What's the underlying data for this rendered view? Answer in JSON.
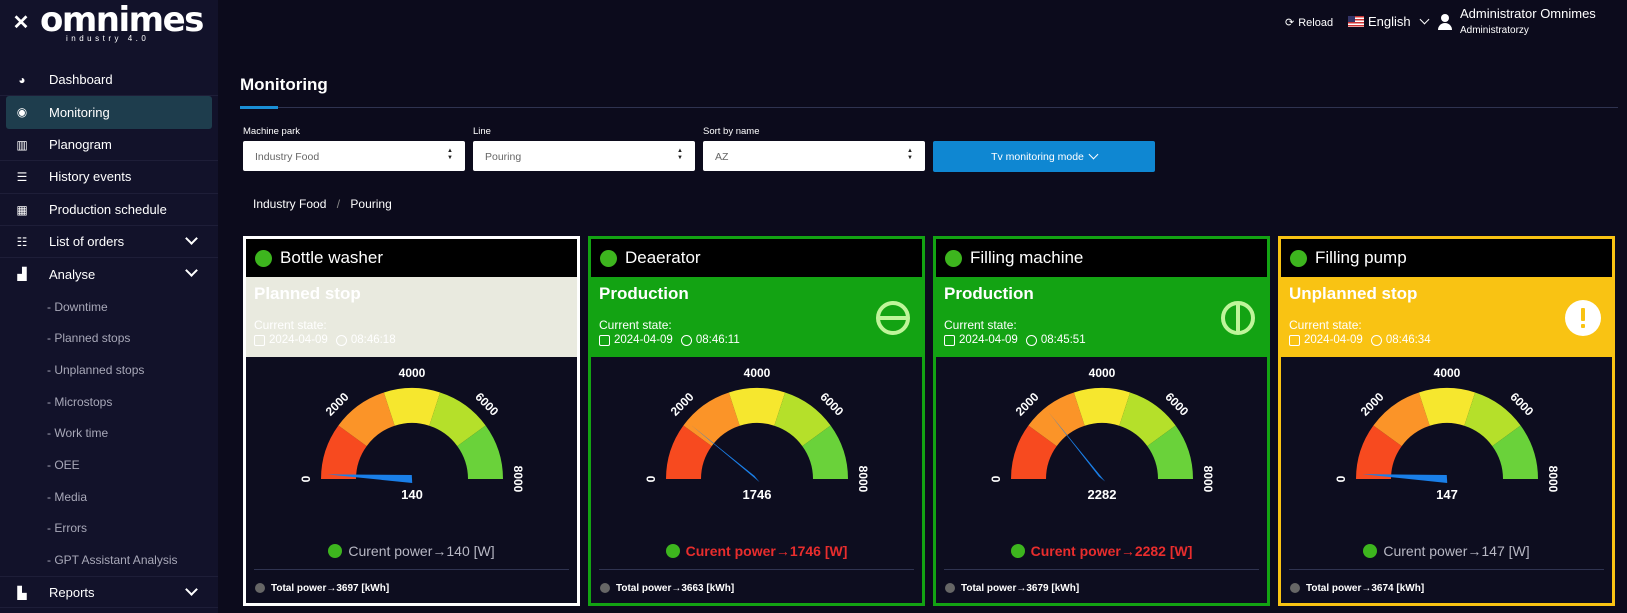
{
  "app": {
    "logo": "omnimes",
    "logo_sub": "industry 4.0"
  },
  "topbar": {
    "reload": "Reload",
    "language": "English",
    "user_name": "Administrator Omnimes",
    "user_role": "Administratorzy"
  },
  "sidebar": {
    "items": [
      {
        "label": "Dashboard",
        "icon": "dashboard-icon"
      },
      {
        "label": "Monitoring",
        "icon": "eye-icon",
        "active": true
      },
      {
        "label": "Planogram",
        "icon": "map-icon"
      },
      {
        "label": "History events",
        "icon": "list-icon"
      },
      {
        "label": "Production schedule",
        "icon": "calendar-icon"
      },
      {
        "label": "List of orders",
        "icon": "list-ordered-icon",
        "expandable": true
      },
      {
        "label": "Analyse",
        "icon": "chart-icon",
        "expandable": true
      }
    ],
    "sub_items": [
      "- Downtime",
      "- Planned stops",
      "- Unplanned stops",
      "- Microstops",
      "- Work time",
      "- OEE",
      "- Media",
      "- Errors",
      "- GPT Assistant Analysis"
    ],
    "reports": "Reports"
  },
  "main": {
    "title": "Monitoring",
    "filters": {
      "machine_park": {
        "label": "Machine park",
        "value": "Industry Food"
      },
      "line": {
        "label": "Line",
        "value": "Pouring"
      },
      "sort": {
        "label": "Sort by name",
        "value": "AZ"
      }
    },
    "tv_mode": "Tv monitoring mode",
    "breadcrumb": [
      "Industry Food",
      "Pouring"
    ]
  },
  "gauge_ticks": [
    "0",
    "2000",
    "4000",
    "6000",
    "8000"
  ],
  "gauge_max": 8000,
  "colors": {
    "production": "#13a313",
    "unplanned": "#f9c313",
    "planned": "#e9eadf",
    "alert": "#e82d2d",
    "accent": "#0f87d2"
  },
  "machines": [
    {
      "name": "Bottle washer",
      "state": "Planned stop",
      "state_label": "Current state:",
      "date": "2024-04-09",
      "time": "08:46:18",
      "power": 140,
      "power_text": "140",
      "current_power": "Curent power→140 [W]",
      "current_alert": false,
      "total_power": "Total power→3697 [kWh]",
      "border": "#ffffff",
      "state_bg": "#e9eadf",
      "state_fg": "#ffffff",
      "state_icon": "none"
    },
    {
      "name": "Deaerator",
      "state": "Production",
      "state_label": "Current state:",
      "date": "2024-04-09",
      "time": "08:46:11",
      "power": 1746,
      "power_text": "1746",
      "current_power": "Curent power→1746 [W]",
      "current_alert": true,
      "total_power": "Total power→3663 [kWh]",
      "border": "#13a313",
      "state_bg": "#13a313",
      "state_fg": "#ffffff",
      "state_icon": "stop-circle-icon"
    },
    {
      "name": "Filling machine",
      "state": "Production",
      "state_label": "Current state:",
      "date": "2024-04-09",
      "time": "08:45:51",
      "power": 2282,
      "power_text": "2282",
      "current_power": "Curent power→2282 [W]",
      "current_alert": true,
      "total_power": "Total power→3679 [kWh]",
      "border": "#13a313",
      "state_bg": "#13a313",
      "state_fg": "#ffffff",
      "state_icon": "power-circle-icon"
    },
    {
      "name": "Filling pump",
      "state": "Unplanned stop",
      "state_label": "Current state:",
      "date": "2024-04-09",
      "time": "08:46:34",
      "power": 147,
      "power_text": "147",
      "current_power": "Curent power→147 [W]",
      "current_alert": false,
      "total_power": "Total power→3674 [kWh]",
      "border": "#f9c313",
      "state_bg": "#f9c313",
      "state_fg": "#ffffff",
      "state_icon": "exclamation-circle-icon"
    }
  ]
}
